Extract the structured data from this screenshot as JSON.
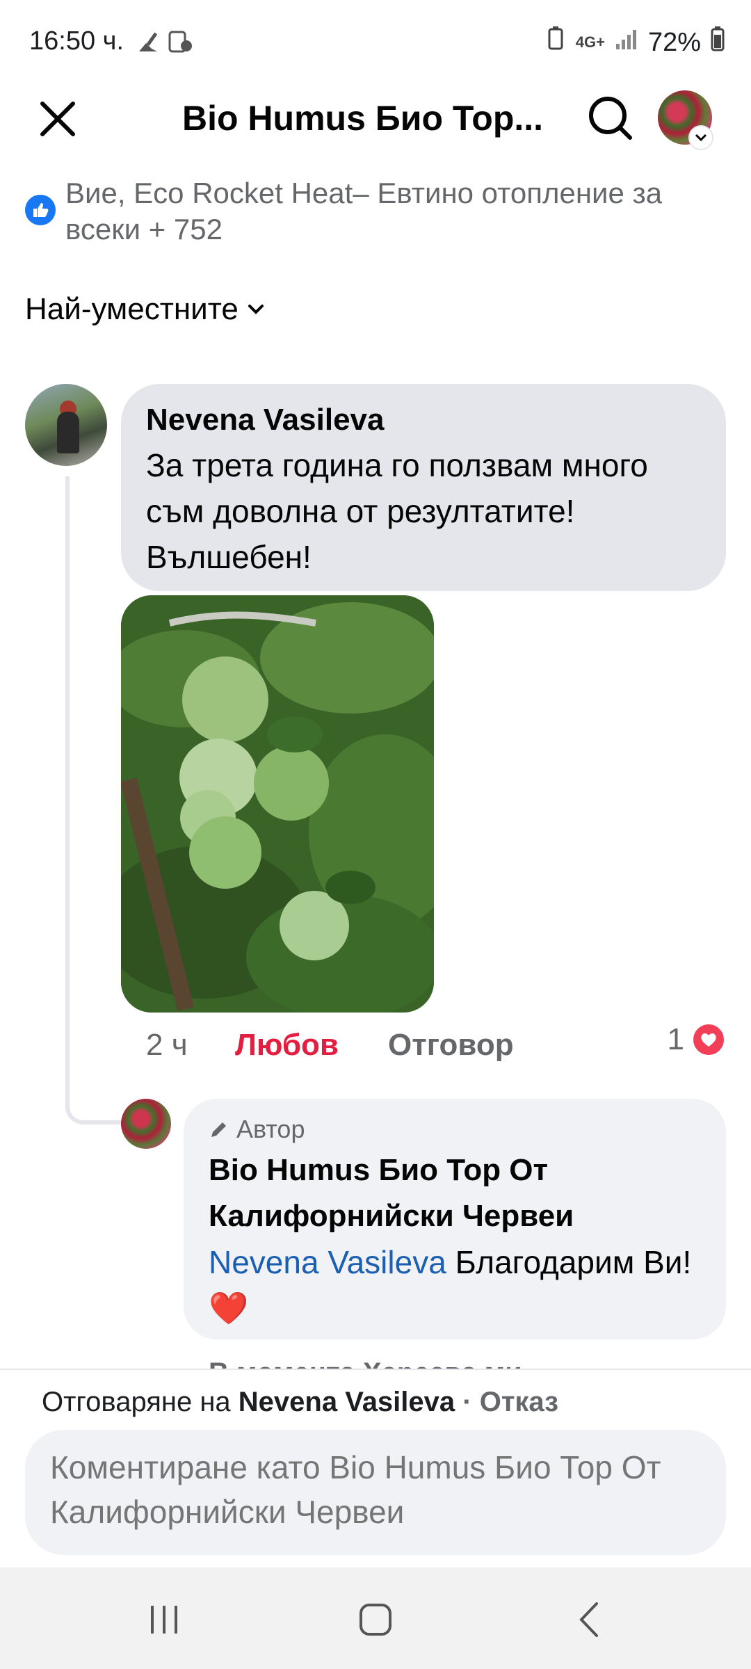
{
  "status_bar": {
    "time": "16:50 ч.",
    "battery": "72%",
    "network": "4G+"
  },
  "header": {
    "title": "Bio Humus Био Тор...",
    "close_icon": "close-icon",
    "search_icon": "search-icon"
  },
  "reactions_summary": {
    "text": "Вие, Eco Rocket Heat– Евтино отопление за всеки + 752"
  },
  "sort": {
    "label": "Най-уместните"
  },
  "comment": {
    "author": "Nevena Vasileva",
    "text": "За трета година го ползвам много съм доволна от резултатите!Вълшебен!",
    "time": "2 ч",
    "reaction_label": "Любов",
    "reply_label": "Отговор",
    "reaction_count": "1"
  },
  "reply": {
    "author_tag": "Автор",
    "author": "Bio Humus Био Тор От Калифорнийски Червеи",
    "mention": "Nevena Vasileva",
    "text": " Благодарим Ви!❤️",
    "meta": "В момента   Харесва ми"
  },
  "composer": {
    "replying_prefix": "Отговаряне на ",
    "replying_to": "Nevena Vasileva",
    "separator": " · ",
    "cancel_label": "Отказ",
    "placeholder": "Коментиране като Bio Humus Био Тор От Калифорнийски Червеи"
  },
  "colors": {
    "accent_blue": "#1877f2",
    "love_red": "#e41e3f",
    "mention_blue": "#1b5fb3",
    "bubble_gray": "#e4e6eb"
  }
}
